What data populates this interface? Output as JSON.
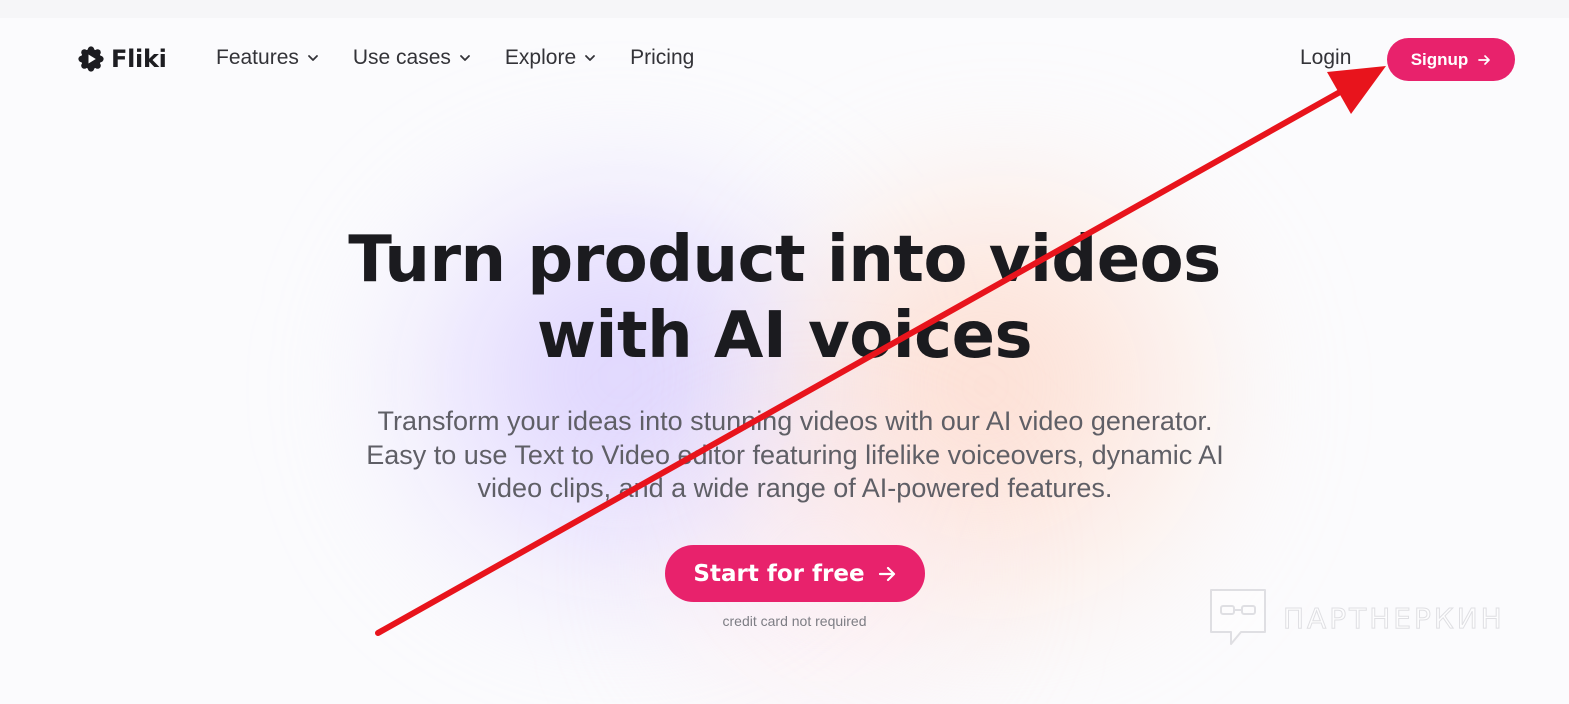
{
  "brand": {
    "name": "Fliki",
    "logo_icon": "fliki-logo-icon"
  },
  "nav": {
    "items": [
      {
        "label": "Features",
        "has_dropdown": true
      },
      {
        "label": "Use cases",
        "has_dropdown": true
      },
      {
        "label": "Explore",
        "has_dropdown": true
      },
      {
        "label": "Pricing",
        "has_dropdown": false
      }
    ],
    "login_label": "Login",
    "signup_label": "Signup",
    "signup_icon": "arrow-right-icon"
  },
  "hero": {
    "title_line1": "Turn product into videos",
    "title_line2": "with AI voices",
    "subtitle_line1": "Transform your ideas into stunning videos with our AI video generator.",
    "subtitle_line2": "Easy to use Text to Video editor featuring lifelike voiceovers, dynamic AI",
    "subtitle_line3": "video clips, and a wide range of AI-powered features.",
    "cta_label": "Start for free",
    "cta_note": "credit card not required"
  },
  "watermark": {
    "text": "ПАРТНЕРКИН"
  },
  "colors": {
    "accent": "#e8226c",
    "annotation_arrow": "#e8141c",
    "title_text": "#1b1b1f",
    "body_text": "#5f5f66"
  }
}
